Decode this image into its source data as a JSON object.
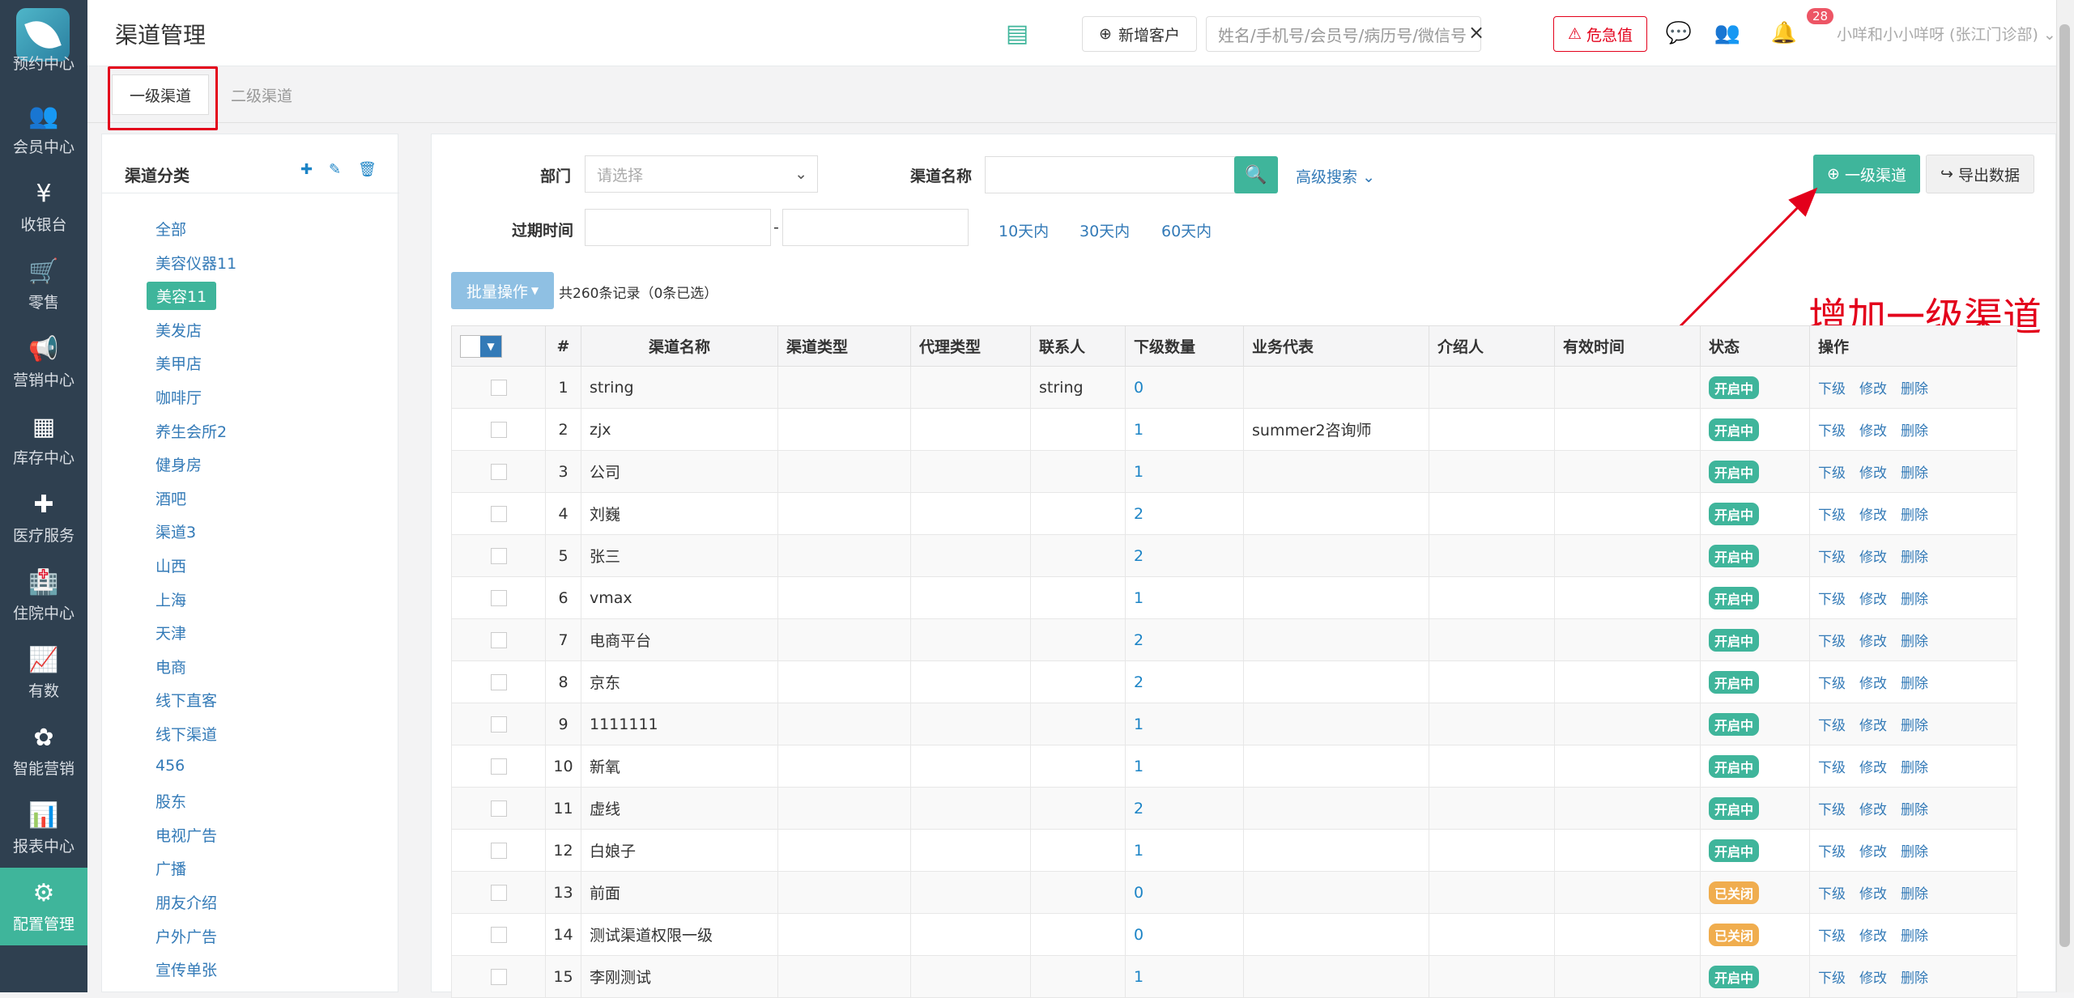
{
  "sidebar": {
    "items": [
      {
        "label": "预约中心",
        "icon": "calendar-icon",
        "glyph": ""
      },
      {
        "label": "会员中心",
        "icon": "users-icon",
        "glyph": "👥"
      },
      {
        "label": "收银台",
        "icon": "yen-icon",
        "glyph": "¥"
      },
      {
        "label": "零售",
        "icon": "cart-icon",
        "glyph": "🛒"
      },
      {
        "label": "营销中心",
        "icon": "megaphone-icon",
        "glyph": "📢"
      },
      {
        "label": "库存中心",
        "icon": "grid-icon",
        "glyph": "▦"
      },
      {
        "label": "医疗服务",
        "icon": "medkit-icon",
        "glyph": "✚"
      },
      {
        "label": "住院中心",
        "icon": "hospital-icon",
        "glyph": "🏥"
      },
      {
        "label": "有数",
        "icon": "line-chart-icon",
        "glyph": "📈"
      },
      {
        "label": "智能营销",
        "icon": "smart-marketing-icon",
        "glyph": "✿"
      },
      {
        "label": "报表中心",
        "icon": "bar-chart-icon",
        "glyph": "📊"
      },
      {
        "label": "配置管理",
        "icon": "gear-icon",
        "glyph": "⚙"
      }
    ]
  },
  "header": {
    "title": "渠道管理",
    "new_customer": "新增客户",
    "search_placeholder": "姓名/手机号/会员号/病历号/微信号",
    "critical": "危急值",
    "notif_count": "28",
    "user": "小咩和小小咩呀 (张江门诊部)"
  },
  "tabs": [
    "一级渠道",
    "二级渠道"
  ],
  "category": {
    "title": "渠道分类",
    "items": [
      "全部",
      "美容仪器11",
      "美容11",
      "美发店",
      "美甲店",
      "咖啡厅",
      "养生会所2",
      "健身房",
      "酒吧",
      "渠道3",
      "山西",
      "上海",
      "天津",
      "电商",
      "线下直客",
      "线下渠道",
      "456",
      "股东",
      "电视广告",
      "广播",
      "朋友介绍",
      "户外广告",
      "宣传单张"
    ],
    "selected": "美容11"
  },
  "filters": {
    "dept_label": "部门",
    "dept_placeholder": "请选择",
    "name_label": "渠道名称",
    "advanced": "高级搜索",
    "expire_label": "过期时间",
    "range_sep": "-",
    "quick": [
      "10天内",
      "30天内",
      "60天内"
    ]
  },
  "actions": {
    "add": "一级渠道",
    "export": "导出数据",
    "batch": "批量操作",
    "total": "共260条记录（0条已选）"
  },
  "annotation": "增加一级渠道",
  "table": {
    "columns": [
      "#",
      "渠道名称",
      "渠道类型",
      "代理类型",
      "联系人",
      "下级数量",
      "业务代表",
      "介绍人",
      "有效时间",
      "状态",
      "操作"
    ],
    "status_labels": {
      "on": "开启中",
      "off": "已关闭"
    },
    "ops": [
      "下级",
      "修改",
      "删除"
    ],
    "rows": [
      {
        "no": "1",
        "name": "string",
        "contact": "string",
        "sub": "0",
        "rep": "",
        "status": "on"
      },
      {
        "no": "2",
        "name": "zjx",
        "contact": "",
        "sub": "1",
        "rep": "summer2咨询师",
        "status": "on"
      },
      {
        "no": "3",
        "name": "公司",
        "contact": "",
        "sub": "1",
        "rep": "",
        "status": "on"
      },
      {
        "no": "4",
        "name": "刘巍",
        "contact": "",
        "sub": "2",
        "rep": "",
        "status": "on"
      },
      {
        "no": "5",
        "name": "张三",
        "contact": "",
        "sub": "2",
        "rep": "",
        "status": "on"
      },
      {
        "no": "6",
        "name": "vmax",
        "contact": "",
        "sub": "1",
        "rep": "",
        "status": "on"
      },
      {
        "no": "7",
        "name": "电商平台",
        "contact": "",
        "sub": "2",
        "rep": "",
        "status": "on"
      },
      {
        "no": "8",
        "name": "京东",
        "contact": "",
        "sub": "2",
        "rep": "",
        "status": "on"
      },
      {
        "no": "9",
        "name": "1111111",
        "contact": "",
        "sub": "1",
        "rep": "",
        "status": "on"
      },
      {
        "no": "10",
        "name": "新氧",
        "contact": "",
        "sub": "1",
        "rep": "",
        "status": "on"
      },
      {
        "no": "11",
        "name": "虚线",
        "contact": "",
        "sub": "2",
        "rep": "",
        "status": "on"
      },
      {
        "no": "12",
        "name": "白娘子",
        "contact": "",
        "sub": "1",
        "rep": "",
        "status": "on"
      },
      {
        "no": "13",
        "name": "前面",
        "contact": "",
        "sub": "0",
        "rep": "",
        "status": "off"
      },
      {
        "no": "14",
        "name": "测试渠道权限一级",
        "contact": "",
        "sub": "0",
        "rep": "",
        "status": "off"
      },
      {
        "no": "15",
        "name": "李刚测试",
        "contact": "",
        "sub": "1",
        "rep": "",
        "status": "on"
      }
    ]
  }
}
